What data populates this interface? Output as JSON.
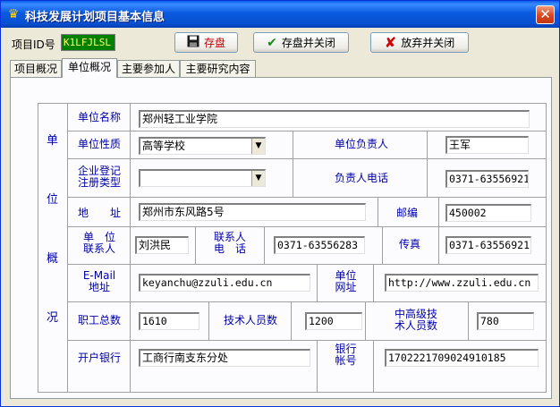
{
  "window": {
    "title": "科技发展计划项目基本信息"
  },
  "toolbar": {
    "project_id_label": "项目ID号",
    "project_id_value": "K1LFJLSL",
    "save_label": "存盘",
    "save_close_label": "存盘并关闭",
    "discard_close_label": "放弃并关闭"
  },
  "tabs": [
    "项目概况",
    "单位概况",
    "主要参加人",
    "主要研究内容"
  ],
  "section": {
    "side_label": [
      "单",
      "位",
      "概",
      "况"
    ]
  },
  "form": {
    "unit_name": {
      "label": "单位名称",
      "value": "郑州轻工业学院"
    },
    "unit_type": {
      "label": "单位性质",
      "value": "高等学校"
    },
    "unit_head": {
      "label": "单位负责人",
      "value": "王军"
    },
    "reg_type": {
      "label_line1": "企业登记",
      "label_line2": "注册类型",
      "value": ""
    },
    "head_phone": {
      "label": "负责人电话",
      "value": "0371-63556921"
    },
    "address": {
      "label": "地　　址",
      "value": "郑州市东风路5号"
    },
    "postcode": {
      "label": "邮编",
      "value": "450002"
    },
    "contact": {
      "label_line1": "单　位",
      "label_line2": "联系人",
      "value": "刘洪民"
    },
    "contact_phone": {
      "label_line1": "联系人",
      "label_line2": "电　话",
      "value": "0371-63556283"
    },
    "fax": {
      "label": "传真",
      "value": "0371-63556921"
    },
    "email": {
      "label_line1": "E-Mail",
      "label_line2": "地址",
      "value": "keyanchu@zzuli.edu.cn"
    },
    "website": {
      "label_line1": "单位",
      "label_line2": "网址",
      "value": "http://www.zzuli.edu.cn"
    },
    "staff_total": {
      "label": "职工总数",
      "value": "1610"
    },
    "tech_staff": {
      "label": "技术人员数",
      "value": "1200"
    },
    "senior_staff": {
      "label_line1": "中高级技",
      "label_line2": "术人员数",
      "value": "780"
    },
    "bank": {
      "label": "开户银行",
      "value": "工商行南支东分处"
    },
    "account": {
      "label_line1": "银行",
      "label_line2": "帐号",
      "value": "1702221709024910185"
    }
  },
  "colors": {
    "title_bar": "#0a5ae0",
    "label_text": "#0000aa",
    "id_field_bg": "#008000",
    "id_field_text": "#ffff66"
  },
  "icons": {
    "title": "crown-icon",
    "save": "floppy-disk-icon",
    "save_close": "checkmark-icon",
    "discard": "red-x-icon",
    "close": "close-icon"
  }
}
